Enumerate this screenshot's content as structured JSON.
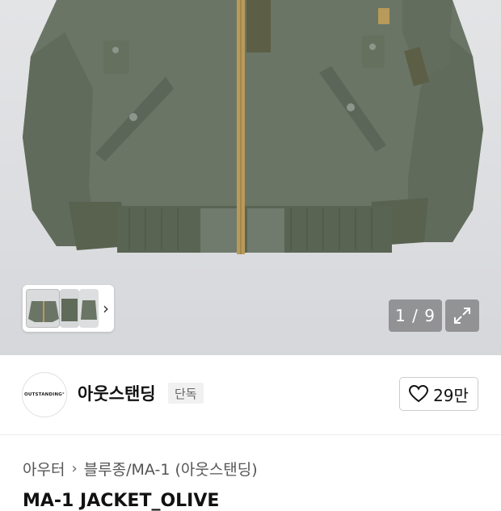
{
  "gallery": {
    "counter": "1 / 9"
  },
  "brand": {
    "logo_text": "OUTSTANDING°",
    "name": "아웃스탠딩",
    "badge": "단독",
    "like_count": "29만"
  },
  "breadcrumb": {
    "category": "아우터",
    "subcategory": "블루종/MA-1 (아웃스탠딩)"
  },
  "product": {
    "title_partial": "MA-1 JACKET_OLIVE"
  },
  "colors": {
    "jacket": "#6b7566",
    "jacket_dark": "#586254",
    "rib": "#5a6453",
    "zipper": "#b89a5a",
    "background": "#dfe0e2"
  }
}
